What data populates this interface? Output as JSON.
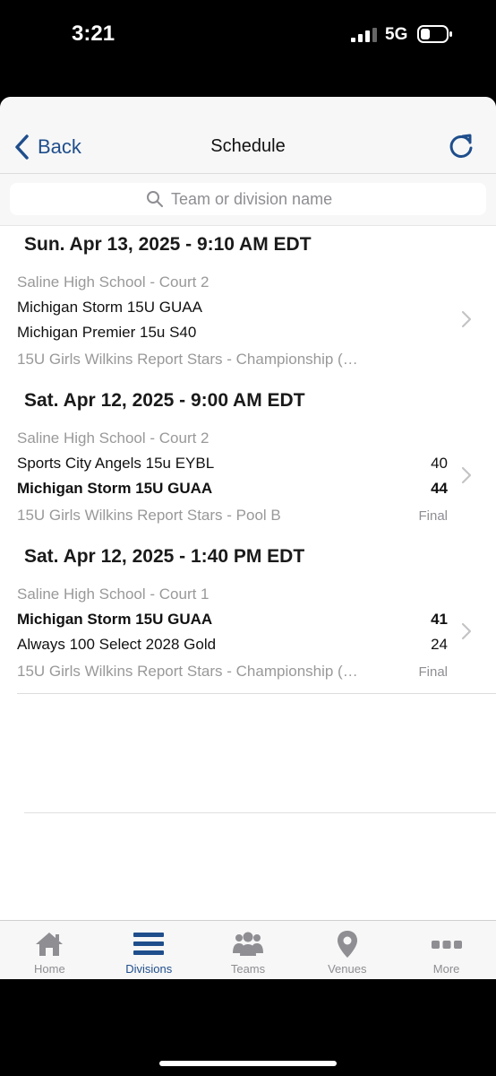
{
  "status_bar": {
    "time": "3:21",
    "network": "5G"
  },
  "nav": {
    "back_label": "Back",
    "title": "Schedule"
  },
  "search": {
    "placeholder": "Team or division name"
  },
  "sections": [
    {
      "header": "Sun. Apr 13, 2025 - 9:10 AM EDT",
      "game": {
        "venue": "Saline High School - Court 2",
        "team1": "Michigan Storm 15U GUAA",
        "team2": "Michigan Premier 15u S40",
        "score1": "",
        "score2": "",
        "division": "15U Girls Wilkins Report Stars - Championship (…",
        "status": ""
      }
    },
    {
      "header": "Sat. Apr 12, 2025 - 9:00 AM EDT",
      "game": {
        "venue": "Saline High School - Court 2",
        "team1": "Sports City Angels 15u EYBL",
        "team2": "Michigan Storm 15U GUAA",
        "score1": "40",
        "score2": "44",
        "division": "15U Girls Wilkins Report Stars - Pool B",
        "status": "Final"
      }
    },
    {
      "header": "Sat. Apr 12, 2025 - 1:40 PM EDT",
      "game": {
        "venue": "Saline High School - Court 1",
        "team1": "Michigan Storm 15U GUAA",
        "team2": "Always 100 Select 2028 Gold",
        "score1": "41",
        "score2": "24",
        "division": "15U Girls Wilkins Report Stars - Championship (…",
        "status": "Final"
      }
    }
  ],
  "tabbar": {
    "items": [
      {
        "label": "Home",
        "icon": "home-icon"
      },
      {
        "label": "Divisions",
        "icon": "menu-icon",
        "active": true
      },
      {
        "label": "Teams",
        "icon": "people-icon"
      },
      {
        "label": "Venues",
        "icon": "location-pin-icon"
      },
      {
        "label": "More",
        "icon": "more-dots-icon"
      }
    ]
  },
  "colors": {
    "accent": "#1f4e8c",
    "inactive_tab": "#8e8e93",
    "secondary_text": "#999999"
  }
}
